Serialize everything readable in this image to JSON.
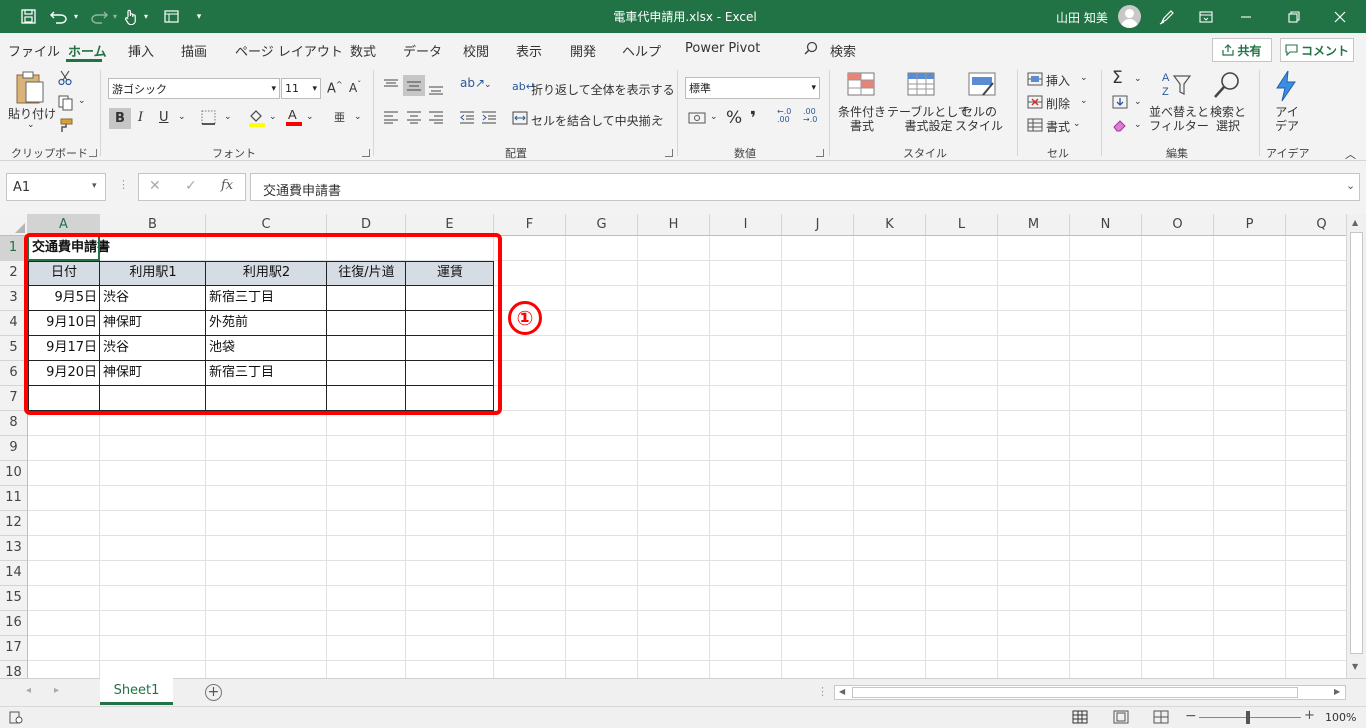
{
  "window": {
    "title": "電車代申請用.xlsx  -  Excel",
    "user_name": "山田 知美"
  },
  "menu": {
    "tabs": [
      "ファイル",
      "ホーム",
      "挿入",
      "描画",
      "ページ レイアウト",
      "数式",
      "データ",
      "校閲",
      "表示",
      "開発",
      "ヘルプ",
      "Power Pivot",
      "検索"
    ],
    "share_label": "共有",
    "comment_label": "コメント"
  },
  "ribbon": {
    "clipboard": {
      "paste_label": "貼り付け",
      "group": "クリップボード"
    },
    "font": {
      "name": "游ゴシック",
      "size": "11",
      "bold": "B",
      "italic": "I",
      "underline": "U",
      "group": "フォント"
    },
    "alignment": {
      "wrap_label": "折り返して全体を表示する",
      "merge_label": "セルを結合して中央揃え",
      "group": "配置"
    },
    "number": {
      "format": "標準",
      "percent": "%",
      "comma": "❜",
      "group": "数値"
    },
    "styles": {
      "conditional": "条件付き\n書式",
      "table": "テーブルとして\n書式設定",
      "cell_styles": "セルの\nスタイル",
      "group": "スタイル"
    },
    "cells": {
      "insert": "挿入",
      "delete": "削除",
      "format": "書式",
      "group": "セル"
    },
    "editing": {
      "sigma": "Σ",
      "sort": "並べ替えと\nフィルター",
      "find": "検索と\n選択",
      "group": "編集"
    },
    "ideas": {
      "label": "アイ\nデア",
      "group": "アイデア"
    }
  },
  "formula_bar": {
    "name_box": "A1",
    "formula": "交通費申請書"
  },
  "sheet": {
    "columns": [
      "A",
      "B",
      "C",
      "D",
      "E",
      "F",
      "G",
      "H",
      "I",
      "J",
      "K",
      "L",
      "M",
      "N",
      "O",
      "P",
      "Q"
    ],
    "rows": [
      "1",
      "2",
      "3",
      "4",
      "5",
      "6",
      "7",
      "8",
      "9",
      "10",
      "11",
      "12",
      "13",
      "14",
      "15",
      "16",
      "17",
      "18"
    ],
    "title": "交通費申請書",
    "headers": [
      "日付",
      "利用駅1",
      "利用駅2",
      "往復/片道",
      "運賃"
    ],
    "data": [
      [
        "9月5日",
        "渋谷",
        "新宿三丁目",
        "",
        ""
      ],
      [
        "9月10日",
        "神保町",
        "外苑前",
        "",
        ""
      ],
      [
        "9月17日",
        "渋谷",
        "池袋",
        "",
        ""
      ],
      [
        "9月20日",
        "神保町",
        "新宿三丁目",
        "",
        ""
      ],
      [
        "",
        "",
        "",
        "",
        ""
      ]
    ],
    "marker": "①"
  },
  "tabs": {
    "sheet_name": "Sheet1"
  },
  "status": {
    "zoom": "100%"
  },
  "colors": {
    "brand": "#217346",
    "highlight": "#ff0000",
    "header_fill": "#d6dce4"
  }
}
